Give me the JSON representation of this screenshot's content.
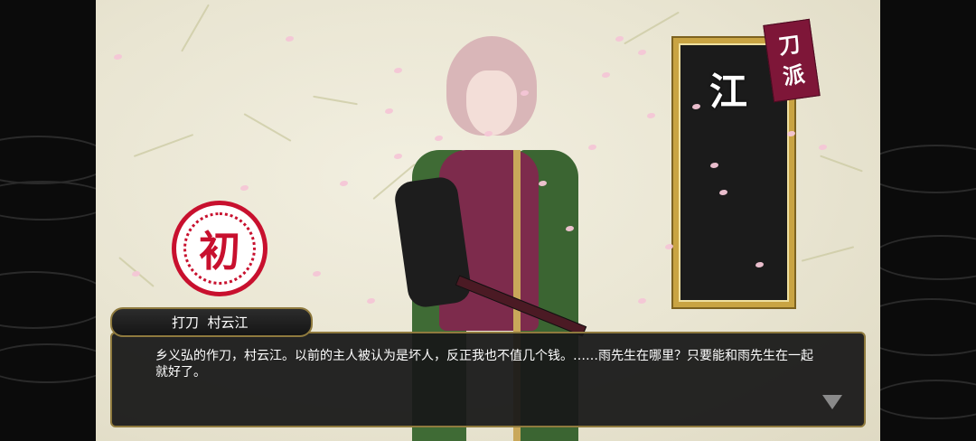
{
  "seal": {
    "char": "初"
  },
  "tablet": {
    "char": "江",
    "tag": [
      "刀",
      "派"
    ]
  },
  "dialogue": {
    "speaker": "打刀  村云江",
    "text": "乡义弘的作刀，村云江。以前的主人被认为是坏人，反正我也不值几个钱。……雨先生在哪里？只要能和雨先生在一起就好了。"
  },
  "colors": {
    "seal_red": "#c8102e",
    "tablet_gold": "#c9a443",
    "tag_crimson": "#7e1638"
  },
  "icons": {
    "advance": "triangle-down-icon"
  }
}
